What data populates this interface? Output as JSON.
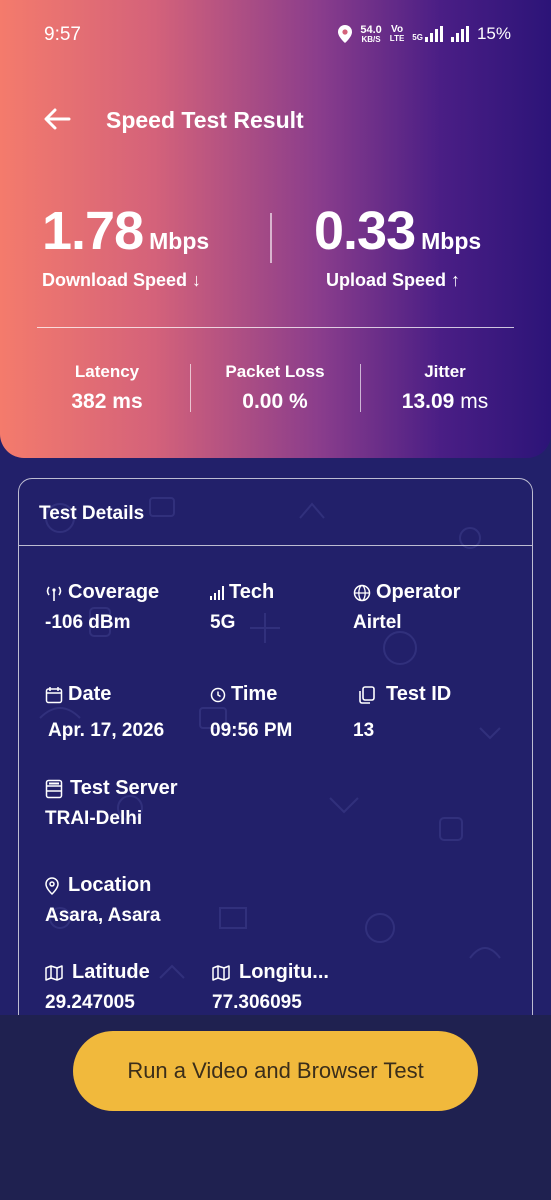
{
  "status": {
    "time": "9:57",
    "speed_value": "54.0",
    "speed_unit": "KB/S",
    "volte_top": "Vo",
    "volte_bottom": "LTE",
    "network_badge": "5G",
    "battery": "15%"
  },
  "header": {
    "title": "Speed Test Result"
  },
  "download": {
    "value": "1.78",
    "unit": "Mbps",
    "label": "Download Speed ↓"
  },
  "upload": {
    "value": "0.33",
    "unit": "Mbps",
    "label": "Upload Speed ↑"
  },
  "metrics": {
    "latency": {
      "label": "Latency",
      "value": "382",
      "unit": "ms"
    },
    "packet_loss": {
      "label": "Packet Loss",
      "value": "0.00",
      "unit": "%"
    },
    "jitter": {
      "label": "Jitter",
      "value": "13.09",
      "unit": "ms"
    }
  },
  "details": {
    "title": "Test Details",
    "coverage": {
      "label": "Coverage",
      "value": "-106 dBm"
    },
    "tech": {
      "label": "Tech",
      "value": "5G"
    },
    "operator": {
      "label": "Operator",
      "value": "Airtel"
    },
    "date": {
      "label": "Date",
      "value": "Apr. 17, 2026"
    },
    "time": {
      "label": "Time",
      "value": "09:56 PM"
    },
    "test_id": {
      "label": "Test ID",
      "value": "13"
    },
    "server": {
      "label": "Test Server",
      "value": "TRAI-Delhi"
    },
    "location": {
      "label": "Location",
      "value": "Asara, Asara"
    },
    "latitude": {
      "label": "Latitude",
      "value": "29.247005"
    },
    "longitude": {
      "label": "Longitu...",
      "value": "77.306095"
    }
  },
  "cta": {
    "label": "Run a Video and Browser Test"
  },
  "colors": {
    "accent": "#f1b93c",
    "background": "#22206a",
    "gradient_start": "#f47b6c",
    "gradient_end": "#2c1478"
  }
}
